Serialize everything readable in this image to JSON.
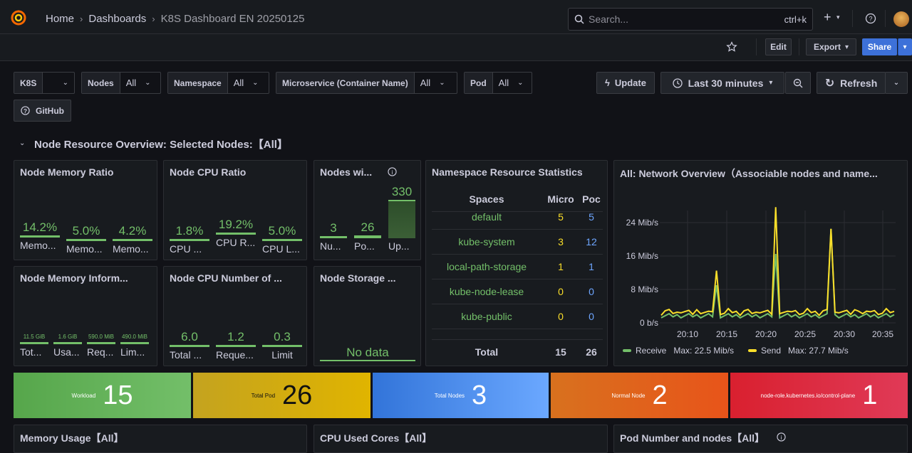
{
  "breadcrumb": {
    "home": "Home",
    "dashboards": "Dashboards",
    "current": "K8S Dashboard EN 20250125"
  },
  "search": {
    "placeholder": "Search...",
    "shortcut": "ctrl+k"
  },
  "toolbar": {
    "edit": "Edit",
    "export": "Export",
    "share": "Share"
  },
  "variables": [
    {
      "label": "K8S",
      "value": ""
    },
    {
      "label": "Nodes",
      "value": "All"
    },
    {
      "label": "Namespace",
      "value": "All"
    },
    {
      "label": "Microservice (Container Name)",
      "value": "All"
    },
    {
      "label": "Pod",
      "value": "All"
    }
  ],
  "controls": {
    "update": "Update",
    "time_range": "Last 30 minutes",
    "refresh": "Refresh",
    "github": "GitHub"
  },
  "row": {
    "title": "Node Resource Overview: Selected Nodes:【All】"
  },
  "panels": {
    "mem_ratio": {
      "title": "Node Memory Ratio",
      "items": [
        {
          "value": "14.2%",
          "label": "Memo..."
        },
        {
          "value": "5.0%",
          "label": "Memo..."
        },
        {
          "value": "4.2%",
          "label": "Memo..."
        }
      ]
    },
    "cpu_ratio": {
      "title": "Node CPU Ratio",
      "items": [
        {
          "value": "1.8%",
          "label": "CPU ..."
        },
        {
          "value": "19.2%",
          "label": "CPU R..."
        },
        {
          "value": "5.0%",
          "label": "CPU L..."
        }
      ]
    },
    "nodes_wi": {
      "title": "Nodes wi...",
      "items": [
        {
          "value": "3",
          "label": "Nu...",
          "level": 0.01
        },
        {
          "value": "26",
          "label": "Po...",
          "level": 0.08
        },
        {
          "value": "330",
          "label": "Up...",
          "level": 1.0
        }
      ]
    },
    "ns_stats": {
      "title": "Namespace Resource Statistics",
      "headers": [
        "Spaces",
        "Micro",
        "Poc"
      ],
      "rows": [
        {
          "name": "default",
          "micro": "5",
          "pods": "5"
        },
        {
          "name": "kube-system",
          "micro": "3",
          "pods": "12"
        },
        {
          "name": "local-path-storage",
          "micro": "1",
          "pods": "1"
        },
        {
          "name": "kube-node-lease",
          "micro": "0",
          "pods": "0"
        },
        {
          "name": "kube-public",
          "micro": "0",
          "pods": "0"
        }
      ],
      "total": {
        "label": "Total",
        "micro": "15",
        "pods": "26"
      }
    },
    "mem_info": {
      "title": "Node Memory Inform...",
      "items": [
        {
          "value": "11.5 GiB",
          "label": "Tot..."
        },
        {
          "value": "1.6 GiB",
          "label": "Usa..."
        },
        {
          "value": "590.0 MiB",
          "label": "Req..."
        },
        {
          "value": "490.0 MiB",
          "label": "Lim..."
        }
      ]
    },
    "cpu_num": {
      "title": "Node CPU Number of ...",
      "items": [
        {
          "value": "6.0",
          "label": "Total ..."
        },
        {
          "value": "1.2",
          "label": "Reque..."
        },
        {
          "value": "0.3",
          "label": "Limit"
        }
      ]
    },
    "storage": {
      "title": "Node Storage ...",
      "nodata": "No data"
    },
    "network": {
      "title": "All: Network Overview（Associable nodes and name...",
      "y_ticks": [
        "24 Mib/s",
        "16 Mib/s",
        "8 Mib/s",
        "0 b/s"
      ],
      "x_ticks": [
        "20:10",
        "20:15",
        "20:20",
        "20:25",
        "20:30",
        "20:35"
      ],
      "legend": [
        {
          "name": "Receive",
          "max": "Max: 22.5 Mib/s",
          "color": "#73bf69"
        },
        {
          "name": "Send",
          "max": "Max: 27.7 Mib/s",
          "color": "#fade2a"
        }
      ]
    }
  },
  "stats": [
    {
      "label": "Workload",
      "value": "15"
    },
    {
      "label": "Total Pod",
      "value": "26"
    },
    {
      "label": "Total Nodes",
      "value": "3"
    },
    {
      "label": "Normal Node",
      "value": "2"
    },
    {
      "label": "node-role.kubernetes.io/control-plane",
      "value": "1"
    }
  ],
  "bottom_panels": [
    {
      "title": "Memory Usage【All】"
    },
    {
      "title": "CPU Used Cores【All】"
    },
    {
      "title": "Pod Number and nodes【All】"
    }
  ]
}
